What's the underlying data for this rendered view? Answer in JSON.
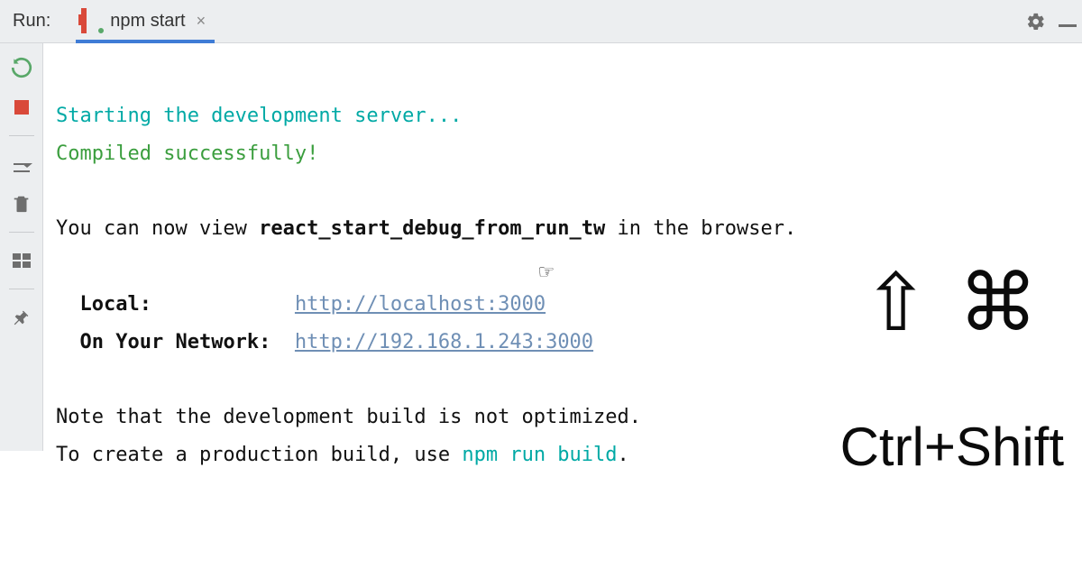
{
  "topbar": {
    "run_label": "Run:",
    "tab_label": "npm start",
    "tab_close_glyph": "×"
  },
  "console": {
    "line1": "Starting the development server...",
    "line2": "Compiled successfully!",
    "view_prefix": "You can now view ",
    "app_name": "react_start_debug_from_run_tw",
    "view_suffix": " in the browser.",
    "local_label": "Local:",
    "local_url": "http://localhost:3000",
    "network_label": "On Your Network:",
    "network_url": "http://192.168.1.243:3000",
    "note_line1": "Note that the development build is not optimized.",
    "note_line2_prefix": "To create a production build, use ",
    "note_line2_cmd": "npm run build",
    "note_line2_suffix": "."
  },
  "overlay": {
    "symbols": "⇧ ⌘",
    "shortcut_text": "Ctrl+Shift"
  }
}
